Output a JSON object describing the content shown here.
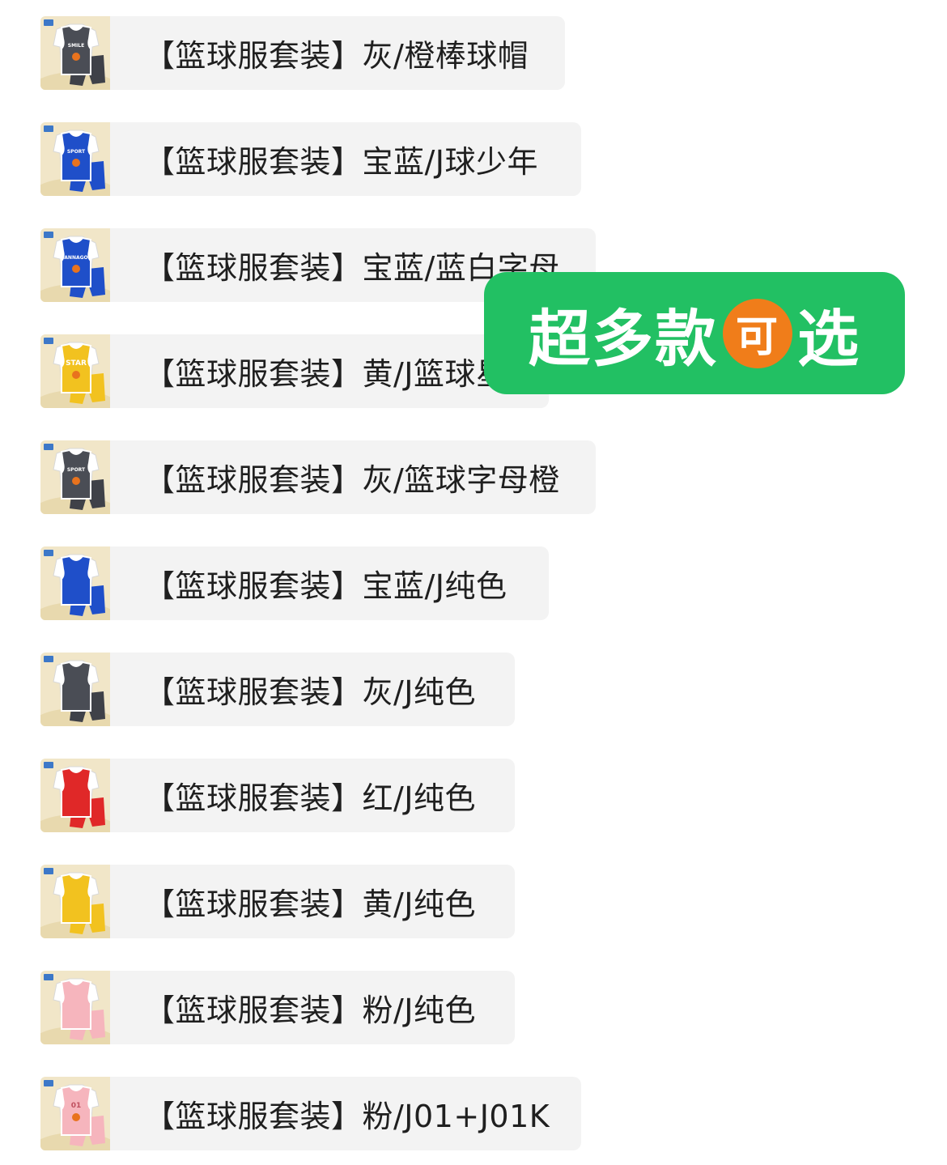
{
  "items": [
    {
      "label": "【篮球服套装】灰/橙棒球帽",
      "jersey_color": "#4a4d55",
      "shorts_color": "#3f4148",
      "print": "SMILE"
    },
    {
      "label": "【篮球服套装】宝蓝/J球少年",
      "jersey_color": "#1f4fc9",
      "shorts_color": "#1f4fc9",
      "print": "SPORT"
    },
    {
      "label": "【篮球服套装】宝蓝/蓝白字母",
      "jersey_color": "#1f4fc9",
      "shorts_color": "#1f4fc9",
      "print": "DANNAGON"
    },
    {
      "label": "【篮球服套装】黄/J篮球星",
      "jersey_color": "#f2c21f",
      "shorts_color": "#f2c21f",
      "print": "STAR"
    },
    {
      "label": "【篮球服套装】灰/篮球字母橙",
      "jersey_color": "#4a4d55",
      "shorts_color": "#3f4148",
      "print": "SPORT"
    },
    {
      "label": "【篮球服套装】宝蓝/J纯色",
      "jersey_color": "#1f4fc9",
      "shorts_color": "#1f4fc9",
      "print": ""
    },
    {
      "label": "【篮球服套装】灰/J纯色",
      "jersey_color": "#4a4d55",
      "shorts_color": "#3f4148",
      "print": ""
    },
    {
      "label": "【篮球服套装】红/J纯色",
      "jersey_color": "#e02828",
      "shorts_color": "#e02828",
      "print": ""
    },
    {
      "label": "【篮球服套装】黄/J纯色",
      "jersey_color": "#f2c21f",
      "shorts_color": "#f2c21f",
      "print": ""
    },
    {
      "label": "【篮球服套装】粉/J纯色",
      "jersey_color": "#f6b5bd",
      "shorts_color": "#f6b5bd",
      "print": ""
    },
    {
      "label": "【篮球服套装】粉/J01+J01K",
      "jersey_color": "#f6b5bd",
      "shorts_color": "#f6b5bd",
      "print": "01"
    }
  ],
  "promo": {
    "text_before": "超多款",
    "badge": "可",
    "text_after": "选",
    "background": "#22c063",
    "badge_color": "#f07d1a"
  }
}
